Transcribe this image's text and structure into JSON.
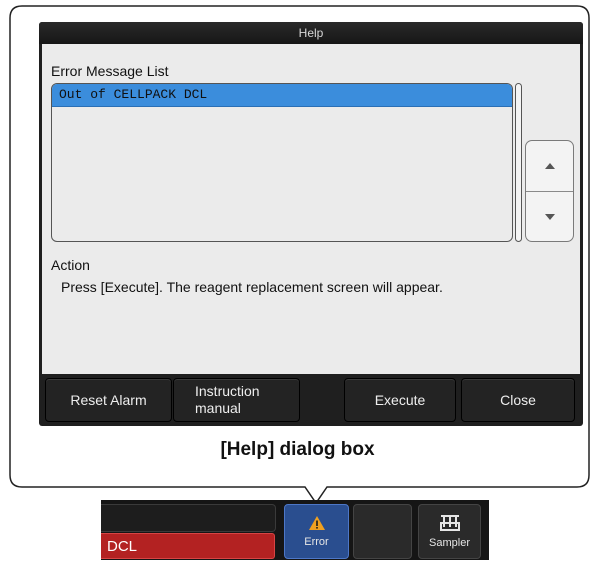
{
  "dialog": {
    "title": "Help",
    "list_label": "Error Message List",
    "messages": [
      "Out of CELLPACK DCL"
    ],
    "action_label": "Action",
    "action_text": "Press [Execute]. The reagent replacement screen will appear.",
    "buttons": {
      "reset_alarm": "Reset Alarm",
      "instruction_line1": "Instruction",
      "instruction_line2": "manual",
      "execute": "Execute",
      "close": "Close"
    }
  },
  "caption": "[Help] dialog box",
  "statusbar": {
    "message": "DCL",
    "error_label": "Error",
    "sampler_label": "Sampler"
  },
  "colors": {
    "selected_row": "#3b8ddc",
    "error_button": "#2a4e8f",
    "alarm_field": "#b32222",
    "warning_icon": "#f0a020"
  },
  "icons": [
    "chevron-up-icon",
    "chevron-down-icon",
    "warning-icon",
    "sampler-rack-icon"
  ]
}
